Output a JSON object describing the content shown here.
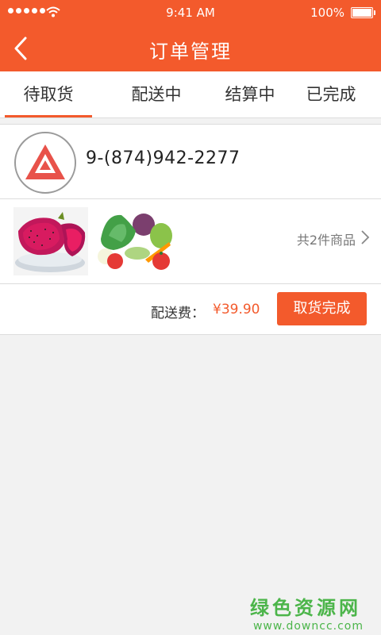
{
  "status_bar": {
    "time": "9:41 AM",
    "battery": "100%"
  },
  "nav": {
    "title": "订单管理",
    "back_icon": "chevron-left-icon"
  },
  "tabs": [
    {
      "label": "待取货",
      "active": true
    },
    {
      "label": "配送中",
      "active": false
    },
    {
      "label": "结算中",
      "active": false
    },
    {
      "label": "已完成",
      "active": false
    }
  ],
  "order": {
    "phone": "9-(874)942-2277",
    "goods_count": "共2件商品",
    "fee_label": "配送费：",
    "fee_amount": "¥39.90",
    "action_label": "取货完成",
    "thumbnails": [
      "dragon-fruit-image",
      "vegetables-image"
    ]
  },
  "watermark": {
    "title": "绿色资源网",
    "url": "www.downcc.com"
  },
  "colors": {
    "accent": "#f35a2c",
    "watermark": "#4cb54a"
  }
}
